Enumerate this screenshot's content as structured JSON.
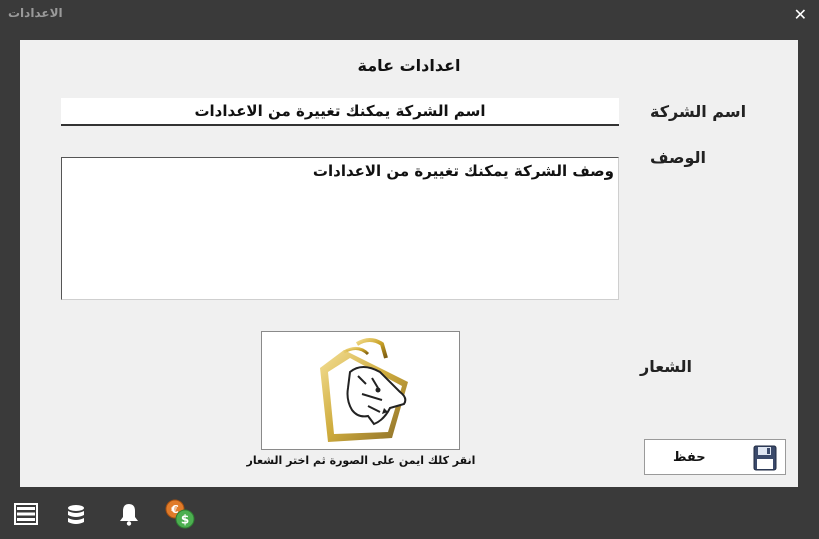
{
  "window": {
    "title": "الاعدادات",
    "close_label": "✕"
  },
  "form": {
    "heading": "اعدادات عامة",
    "company_name_label": "اسم الشركة",
    "company_name_value": "اسم الشركة يمكنك تغييرة من الاعدادات",
    "description_label": "الوصف",
    "description_value": "وصف الشركة يمكنك تغييرة من الاعدادات",
    "logo_label": "الشعار",
    "logo_hint": "انقر كلك ايمن على الصورة ثم اختر الشعار",
    "save_label": "حفظ"
  },
  "taskbar": {
    "icons": [
      "server-list-icon",
      "database-icon",
      "bell-icon",
      "currency-exchange-icon"
    ]
  },
  "colors": {
    "window_bg": "#3a3a3a",
    "panel_bg": "#f0f0f0",
    "logo_gold": "#c9a227"
  }
}
